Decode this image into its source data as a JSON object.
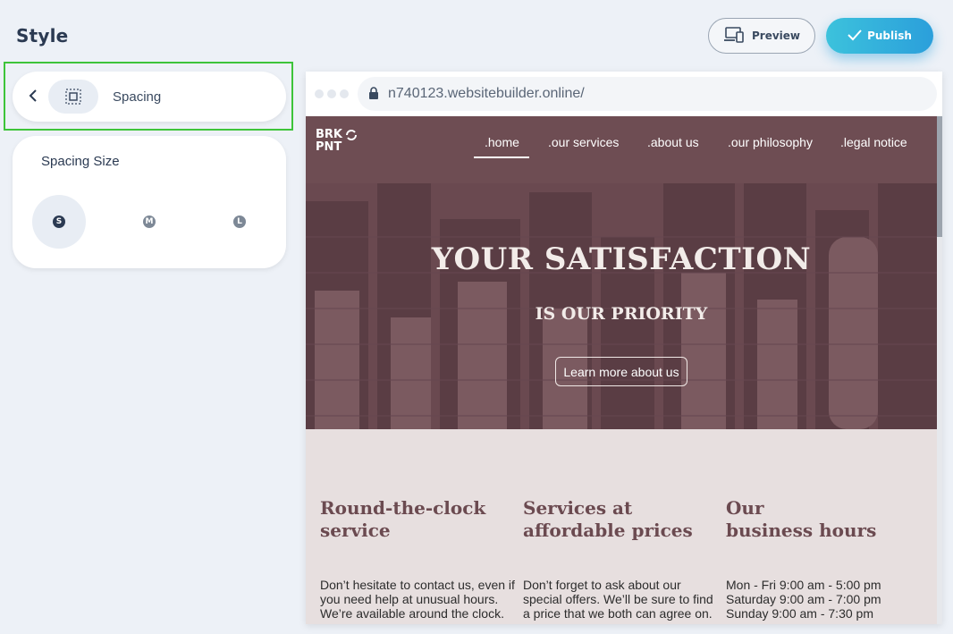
{
  "panel": {
    "title": "Style",
    "spacing_label": "Spacing",
    "size_title": "Spacing Size",
    "sizes": [
      "S",
      "M",
      "L"
    ],
    "selected_size": "S"
  },
  "toolbar": {
    "preview_label": "Preview",
    "publish_label": "Publish"
  },
  "browser": {
    "url": "n740123.websitebuilder.online/"
  },
  "site": {
    "logo_line1": "BRK",
    "logo_line2": "PNT",
    "nav": [
      ".home",
      ".our services",
      ".about us",
      ".our philosophy",
      ".legal notice"
    ],
    "active_nav": ".home",
    "hero_title": "YOUR SATISFACTION",
    "hero_subtitle": "IS OUR PRIORITY",
    "hero_button": "Learn more about us",
    "columns": [
      {
        "title_line1": "Round-the-clock",
        "title_line2": "service",
        "lines": [
          "Don’t hesitate to contact us, even if",
          "you need help at unusual hours.",
          "We’re available around the clock."
        ]
      },
      {
        "title_line1": "Services at",
        "title_line2": "affordable prices",
        "lines": [
          "Don’t forget to ask about our",
          "special offers. We’ll be sure to find",
          "a price that we both can agree on."
        ]
      },
      {
        "title_line1": "Our",
        "title_line2": "business hours",
        "lines": [
          "Mon - Fri 9:00 am - 5:00 pm",
          "Saturday 9:00 am - 7:00 pm",
          "Sunday 9:00 am - 7:30 pm"
        ]
      }
    ]
  },
  "colors": {
    "accent": "#2b9fdb",
    "hero": "#6b4a50",
    "highlight": "#3ec43a"
  }
}
